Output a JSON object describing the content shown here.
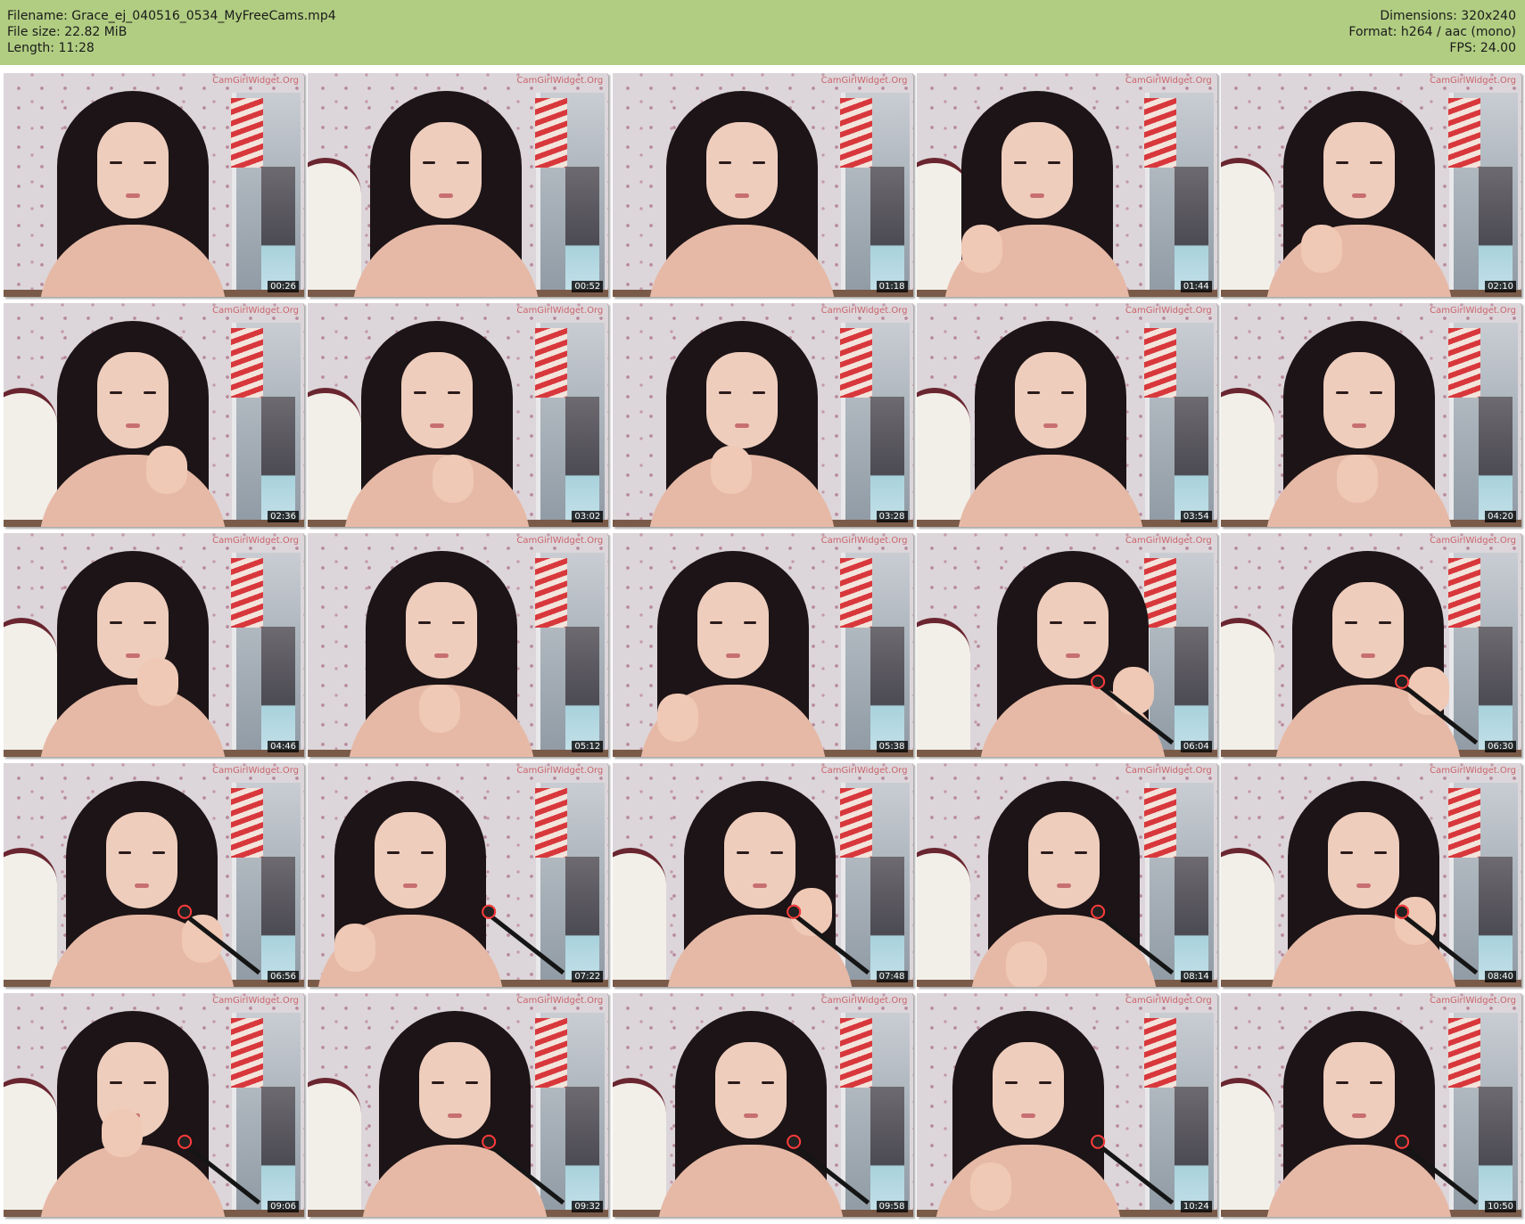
{
  "header": {
    "filename": "Filename: Grace_ej_040516_0534_MyFreeCams.mp4",
    "filesize": "File size: 22.82 MiB",
    "length": "Length: 11:28",
    "dimensions": "Dimensions: 320x240",
    "format": "Format: h264 / aac (mono)",
    "fps": "FPS: 24.00"
  },
  "colors": {
    "header_background": "#b1cd82",
    "timestamp_background": "#000000",
    "watermark": "#c6474f"
  },
  "thumbnails": [
    {
      "time": "00:26"
    },
    {
      "time": "00:52"
    },
    {
      "time": "01:18"
    },
    {
      "time": "01:44"
    },
    {
      "time": "02:10"
    },
    {
      "time": "02:36"
    },
    {
      "time": "03:02"
    },
    {
      "time": "03:28"
    },
    {
      "time": "03:54"
    },
    {
      "time": "04:20"
    },
    {
      "time": "04:46"
    },
    {
      "time": "05:12"
    },
    {
      "time": "05:38"
    },
    {
      "time": "06:04"
    },
    {
      "time": "06:30"
    },
    {
      "time": "06:56"
    },
    {
      "time": "07:22"
    },
    {
      "time": "07:48"
    },
    {
      "time": "08:14"
    },
    {
      "time": "08:40"
    },
    {
      "time": "09:06"
    },
    {
      "time": "09:32"
    },
    {
      "time": "09:58"
    },
    {
      "time": "10:24"
    },
    {
      "time": "10:50"
    }
  ],
  "watermark_text": "CamGirlWidget.Org"
}
